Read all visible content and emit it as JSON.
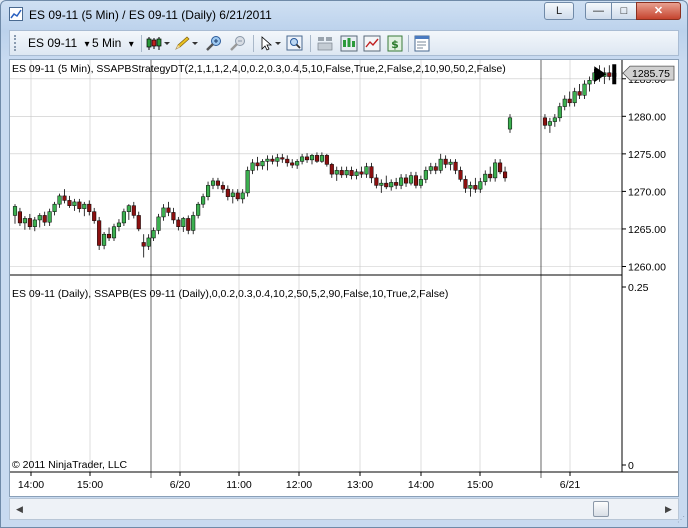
{
  "window": {
    "title": "ES 09-11 (5 Min) / ES 09-11 (Daily)  6/21/2011",
    "link_button": "L",
    "min_glyph": "—",
    "max_glyph": "□",
    "close_glyph": "✕"
  },
  "toolbar": {
    "instrument": "ES 09-11",
    "interval": "5 Min",
    "dropdown_glyph": "▾",
    "icons": [
      "chart-style-icon",
      "pencil-draw-icon",
      "zoom-in-icon",
      "zoom-out-icon",
      "cursor-pointer-icon",
      "magnifier-icon",
      "data-box-icon",
      "strategies-icon",
      "chart-trader-icon",
      "dollar-icon",
      "properties-icon"
    ]
  },
  "colors": {
    "up_candle": "#3cb050",
    "down_candle": "#8b1010",
    "wick": "#000000",
    "grid": "#c8c8c8",
    "price_marker": "#d0d0d0"
  },
  "upper_panel": {
    "label": "ES 09-11 (5 Min), SSAPBStrategyDT(2,1,1,1,2,4,0,0.2,0.3,0.4,5,10,False,True,2,False,2,10,90,50,2,False)",
    "last_price": "1285.75",
    "y_ticks": [
      "1285.00",
      "1280.00",
      "1275.00",
      "1270.00",
      "1265.00",
      "1260.00"
    ]
  },
  "lower_panel": {
    "label": "ES 09-11 (Daily), SSAPB(ES 09-11 (Daily),0,0.2,0.3,0.4,10,2,50,5,2,90,False,10,True,2,False)",
    "y_ticks": [
      "0.25",
      "0"
    ],
    "copyright": "© 2011 NinjaTrader, LLC"
  },
  "x_axis": {
    "ticks": [
      "14:00",
      "15:00",
      "6/20",
      "11:00",
      "12:00",
      "13:00",
      "14:00",
      "15:00",
      "6/21"
    ]
  },
  "chart_data": {
    "type": "candlestick",
    "instrument": "ES 09-11",
    "interval": "5 Min",
    "ylim": [
      1260,
      1287
    ],
    "candles": [
      {
        "o": 1266.8,
        "h": 1268.3,
        "l": 1265.7,
        "c": 1268.0
      },
      {
        "o": 1267.3,
        "h": 1267.8,
        "l": 1265.4,
        "c": 1265.8
      },
      {
        "o": 1265.8,
        "h": 1266.7,
        "l": 1264.9,
        "c": 1266.4
      },
      {
        "o": 1266.4,
        "h": 1267.0,
        "l": 1264.9,
        "c": 1265.3
      },
      {
        "o": 1265.3,
        "h": 1266.6,
        "l": 1264.7,
        "c": 1266.2
      },
      {
        "o": 1266.2,
        "h": 1267.1,
        "l": 1265.2,
        "c": 1266.8
      },
      {
        "o": 1266.8,
        "h": 1267.3,
        "l": 1265.4,
        "c": 1265.9
      },
      {
        "o": 1265.9,
        "h": 1267.7,
        "l": 1265.4,
        "c": 1267.3
      },
      {
        "o": 1267.3,
        "h": 1268.6,
        "l": 1266.8,
        "c": 1268.3
      },
      {
        "o": 1268.3,
        "h": 1269.7,
        "l": 1267.8,
        "c": 1269.4
      },
      {
        "o": 1269.4,
        "h": 1270.3,
        "l": 1268.4,
        "c": 1268.8
      },
      {
        "o": 1268.8,
        "h": 1269.4,
        "l": 1267.8,
        "c": 1268.1
      },
      {
        "o": 1268.1,
        "h": 1269.0,
        "l": 1267.4,
        "c": 1268.6
      },
      {
        "o": 1268.6,
        "h": 1269.0,
        "l": 1267.2,
        "c": 1267.7
      },
      {
        "o": 1267.7,
        "h": 1268.6,
        "l": 1266.7,
        "c": 1268.3
      },
      {
        "o": 1268.3,
        "h": 1268.8,
        "l": 1266.8,
        "c": 1267.3
      },
      {
        "o": 1267.3,
        "h": 1267.8,
        "l": 1265.7,
        "c": 1266.1
      },
      {
        "o": 1266.1,
        "h": 1266.6,
        "l": 1262.2,
        "c": 1262.8
      },
      {
        "o": 1262.8,
        "h": 1264.6,
        "l": 1262.3,
        "c": 1264.3
      },
      {
        "o": 1264.3,
        "h": 1265.2,
        "l": 1263.4,
        "c": 1263.8
      },
      {
        "o": 1263.8,
        "h": 1265.7,
        "l": 1263.4,
        "c": 1265.3
      },
      {
        "o": 1265.3,
        "h": 1266.3,
        "l": 1264.7,
        "c": 1265.8
      },
      {
        "o": 1265.8,
        "h": 1267.7,
        "l": 1265.4,
        "c": 1267.3
      },
      {
        "o": 1267.3,
        "h": 1268.3,
        "l": 1266.2,
        "c": 1268.1
      },
      {
        "o": 1268.1,
        "h": 1268.6,
        "l": 1266.4,
        "c": 1266.8
      },
      {
        "o": 1266.8,
        "h": 1267.3,
        "l": 1264.7,
        "c": 1265.0
      },
      {
        "o": 1263.2,
        "h": 1264.3,
        "l": 1261.2,
        "c": 1262.7
      },
      {
        "o": 1262.7,
        "h": 1264.3,
        "l": 1262.2,
        "c": 1263.8
      },
      {
        "o": 1263.8,
        "h": 1265.2,
        "l": 1263.4,
        "c": 1264.8
      },
      {
        "o": 1264.8,
        "h": 1267.0,
        "l": 1264.3,
        "c": 1266.6
      },
      {
        "o": 1266.6,
        "h": 1268.3,
        "l": 1266.1,
        "c": 1267.8
      },
      {
        "o": 1267.8,
        "h": 1268.6,
        "l": 1266.7,
        "c": 1267.2
      },
      {
        "o": 1267.2,
        "h": 1267.8,
        "l": 1265.7,
        "c": 1266.2
      },
      {
        "o": 1266.2,
        "h": 1266.6,
        "l": 1264.8,
        "c": 1265.3
      },
      {
        "o": 1265.3,
        "h": 1266.6,
        "l": 1264.6,
        "c": 1266.4
      },
      {
        "o": 1266.4,
        "h": 1266.8,
        "l": 1264.3,
        "c": 1264.8
      },
      {
        "o": 1264.8,
        "h": 1267.3,
        "l": 1264.3,
        "c": 1266.8
      },
      {
        "o": 1266.8,
        "h": 1268.6,
        "l": 1266.4,
        "c": 1268.3
      },
      {
        "o": 1268.3,
        "h": 1269.7,
        "l": 1267.8,
        "c": 1269.3
      },
      {
        "o": 1269.3,
        "h": 1271.3,
        "l": 1268.8,
        "c": 1270.8
      },
      {
        "o": 1270.8,
        "h": 1271.8,
        "l": 1270.3,
        "c": 1271.4
      },
      {
        "o": 1271.4,
        "h": 1271.8,
        "l": 1270.3,
        "c": 1270.8
      },
      {
        "o": 1270.8,
        "h": 1271.3,
        "l": 1269.8,
        "c": 1270.3
      },
      {
        "o": 1270.3,
        "h": 1270.8,
        "l": 1268.8,
        "c": 1269.3
      },
      {
        "o": 1269.3,
        "h": 1270.3,
        "l": 1268.4,
        "c": 1269.8
      },
      {
        "o": 1269.8,
        "h": 1270.3,
        "l": 1268.7,
        "c": 1269.0
      },
      {
        "o": 1269.0,
        "h": 1270.3,
        "l": 1268.4,
        "c": 1269.8
      },
      {
        "o": 1269.8,
        "h": 1273.3,
        "l": 1269.3,
        "c": 1272.8
      },
      {
        "o": 1272.8,
        "h": 1274.3,
        "l": 1272.3,
        "c": 1273.8
      },
      {
        "o": 1273.8,
        "h": 1274.6,
        "l": 1272.8,
        "c": 1273.4
      },
      {
        "o": 1273.4,
        "h": 1274.3,
        "l": 1272.9,
        "c": 1274.0
      },
      {
        "o": 1274.0,
        "h": 1274.8,
        "l": 1272.8,
        "c": 1274.3
      },
      {
        "o": 1274.3,
        "h": 1274.8,
        "l": 1273.6,
        "c": 1274.0
      },
      {
        "o": 1274.0,
        "h": 1275.0,
        "l": 1273.3,
        "c": 1274.5
      },
      {
        "o": 1274.5,
        "h": 1275.0,
        "l": 1273.8,
        "c": 1274.3
      },
      {
        "o": 1274.3,
        "h": 1274.8,
        "l": 1273.3,
        "c": 1273.8
      },
      {
        "o": 1273.8,
        "h": 1274.3,
        "l": 1273.1,
        "c": 1273.5
      },
      {
        "o": 1273.5,
        "h": 1274.3,
        "l": 1273.0,
        "c": 1274.0
      },
      {
        "o": 1274.0,
        "h": 1275.0,
        "l": 1273.6,
        "c": 1274.6
      },
      {
        "o": 1274.6,
        "h": 1275.1,
        "l": 1273.8,
        "c": 1274.2
      },
      {
        "o": 1274.2,
        "h": 1275.0,
        "l": 1273.6,
        "c": 1274.8
      },
      {
        "o": 1274.8,
        "h": 1275.2,
        "l": 1273.8,
        "c": 1274.0
      },
      {
        "o": 1274.0,
        "h": 1275.2,
        "l": 1273.8,
        "c": 1274.8
      },
      {
        "o": 1274.8,
        "h": 1275.0,
        "l": 1273.3,
        "c": 1273.6
      },
      {
        "o": 1273.6,
        "h": 1273.8,
        "l": 1271.8,
        "c": 1272.3
      },
      {
        "o": 1272.3,
        "h": 1273.3,
        "l": 1271.4,
        "c": 1272.8
      },
      {
        "o": 1272.8,
        "h": 1273.3,
        "l": 1271.8,
        "c": 1272.2
      },
      {
        "o": 1272.2,
        "h": 1273.3,
        "l": 1271.8,
        "c": 1272.8
      },
      {
        "o": 1272.8,
        "h": 1273.3,
        "l": 1271.6,
        "c": 1272.1
      },
      {
        "o": 1272.1,
        "h": 1273.0,
        "l": 1271.6,
        "c": 1272.6
      },
      {
        "o": 1272.6,
        "h": 1273.3,
        "l": 1271.8,
        "c": 1272.3
      },
      {
        "o": 1272.3,
        "h": 1273.8,
        "l": 1271.8,
        "c": 1273.3
      },
      {
        "o": 1273.3,
        "h": 1273.8,
        "l": 1271.1,
        "c": 1271.8
      },
      {
        "o": 1271.8,
        "h": 1272.3,
        "l": 1270.4,
        "c": 1270.8
      },
      {
        "o": 1270.8,
        "h": 1271.6,
        "l": 1269.8,
        "c": 1271.1
      },
      {
        "o": 1271.1,
        "h": 1272.1,
        "l": 1270.3,
        "c": 1270.6
      },
      {
        "o": 1270.6,
        "h": 1271.6,
        "l": 1270.1,
        "c": 1271.2
      },
      {
        "o": 1271.2,
        "h": 1271.8,
        "l": 1270.3,
        "c": 1270.8
      },
      {
        "o": 1270.8,
        "h": 1272.3,
        "l": 1270.3,
        "c": 1271.8
      },
      {
        "o": 1271.8,
        "h": 1272.3,
        "l": 1270.6,
        "c": 1271.1
      },
      {
        "o": 1271.1,
        "h": 1272.6,
        "l": 1270.8,
        "c": 1272.1
      },
      {
        "o": 1272.1,
        "h": 1272.6,
        "l": 1270.4,
        "c": 1270.8
      },
      {
        "o": 1270.8,
        "h": 1272.1,
        "l": 1270.4,
        "c": 1271.6
      },
      {
        "o": 1271.6,
        "h": 1273.3,
        "l": 1271.1,
        "c": 1272.8
      },
      {
        "o": 1272.8,
        "h": 1273.8,
        "l": 1272.3,
        "c": 1273.3
      },
      {
        "o": 1273.3,
        "h": 1273.8,
        "l": 1272.3,
        "c": 1272.8
      },
      {
        "o": 1272.8,
        "h": 1275.0,
        "l": 1272.4,
        "c": 1274.3
      },
      {
        "o": 1274.3,
        "h": 1274.8,
        "l": 1273.1,
        "c": 1273.6
      },
      {
        "o": 1273.6,
        "h": 1274.3,
        "l": 1272.8,
        "c": 1273.9
      },
      {
        "o": 1273.9,
        "h": 1274.3,
        "l": 1272.3,
        "c": 1272.8
      },
      {
        "o": 1272.8,
        "h": 1273.3,
        "l": 1271.3,
        "c": 1271.6
      },
      {
        "o": 1271.6,
        "h": 1272.1,
        "l": 1269.8,
        "c": 1270.4
      },
      {
        "o": 1270.4,
        "h": 1271.3,
        "l": 1269.3,
        "c": 1270.8
      },
      {
        "o": 1270.8,
        "h": 1271.8,
        "l": 1269.8,
        "c": 1270.3
      },
      {
        "o": 1270.3,
        "h": 1271.8,
        "l": 1269.8,
        "c": 1271.3
      },
      {
        "o": 1271.3,
        "h": 1272.8,
        "l": 1270.8,
        "c": 1272.3
      },
      {
        "o": 1272.3,
        "h": 1273.3,
        "l": 1271.3,
        "c": 1271.8
      },
      {
        "o": 1271.8,
        "h": 1274.3,
        "l": 1271.3,
        "c": 1273.8
      },
      {
        "o": 1273.8,
        "h": 1274.3,
        "l": 1272.3,
        "c": 1272.6
      },
      {
        "o": 1272.6,
        "h": 1273.3,
        "l": 1271.3,
        "c": 1271.8
      },
      {
        "o": 1278.3,
        "h": 1280.3,
        "l": 1277.8,
        "c": 1279.8
      },
      {
        "o": 1279.8,
        "h": 1280.3,
        "l": 1278.3,
        "c": 1278.8
      },
      {
        "o": 1278.8,
        "h": 1279.8,
        "l": 1277.8,
        "c": 1279.3
      },
      {
        "o": 1279.3,
        "h": 1280.3,
        "l": 1278.6,
        "c": 1279.8
      },
      {
        "o": 1279.8,
        "h": 1281.8,
        "l": 1279.3,
        "c": 1281.3
      },
      {
        "o": 1281.3,
        "h": 1282.8,
        "l": 1280.8,
        "c": 1282.3
      },
      {
        "o": 1282.3,
        "h": 1283.3,
        "l": 1281.3,
        "c": 1281.8
      },
      {
        "o": 1281.8,
        "h": 1283.8,
        "l": 1281.3,
        "c": 1283.3
      },
      {
        "o": 1283.3,
        "h": 1284.3,
        "l": 1282.3,
        "c": 1282.8
      },
      {
        "o": 1282.8,
        "h": 1284.8,
        "l": 1282.3,
        "c": 1284.3
      },
      {
        "o": 1284.3,
        "h": 1285.3,
        "l": 1283.3,
        "c": 1284.8
      },
      {
        "o": 1284.8,
        "h": 1286.3,
        "l": 1284.3,
        "c": 1285.8
      },
      {
        "o": 1285.8,
        "h": 1286.8,
        "l": 1284.6,
        "c": 1285.3
      },
      {
        "o": 1285.3,
        "h": 1286.5,
        "l": 1284.3,
        "c": 1285.8
      },
      {
        "o": 1285.8,
        "h": 1286.8,
        "l": 1284.8,
        "c": 1285.3
      },
      {
        "o": 1285.3,
        "h": 1286.3,
        "l": 1284.3,
        "c": 1285.75
      }
    ],
    "lower_indicator": {
      "ylim": [
        0,
        0.25
      ]
    }
  }
}
